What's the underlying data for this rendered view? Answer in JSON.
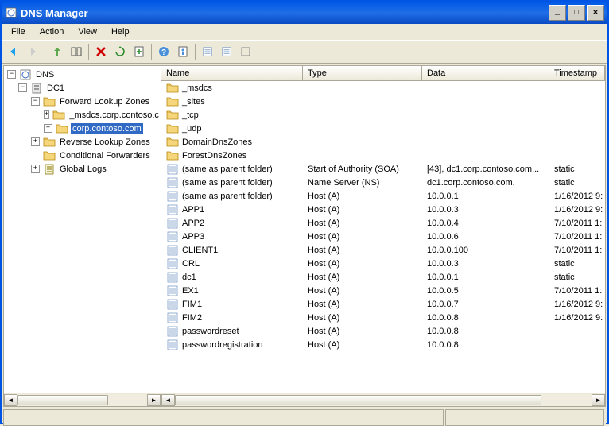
{
  "window": {
    "title": "DNS Manager"
  },
  "menu": {
    "file": "File",
    "action": "Action",
    "view": "View",
    "help": "Help"
  },
  "tree": {
    "root": "DNS",
    "server": "DC1",
    "flz_label": "Forward Lookup Zones",
    "msdcs": "_msdcs.corp.contoso.c",
    "zone": "corp.contoso.com",
    "rlz": "Reverse Lookup Zones",
    "cf": "Conditional Forwarders",
    "gl": "Global Logs"
  },
  "columns": {
    "name": "Name",
    "type": "Type",
    "data": "Data",
    "timestamp": "Timestamp"
  },
  "records": [
    {
      "name": "_msdcs",
      "type": "",
      "data": "",
      "ts": "",
      "icon": "folder"
    },
    {
      "name": "_sites",
      "type": "",
      "data": "",
      "ts": "",
      "icon": "folder"
    },
    {
      "name": "_tcp",
      "type": "",
      "data": "",
      "ts": "",
      "icon": "folder"
    },
    {
      "name": "_udp",
      "type": "",
      "data": "",
      "ts": "",
      "icon": "folder"
    },
    {
      "name": "DomainDnsZones",
      "type": "",
      "data": "",
      "ts": "",
      "icon": "folder"
    },
    {
      "name": "ForestDnsZones",
      "type": "",
      "data": "",
      "ts": "",
      "icon": "folder"
    },
    {
      "name": "(same as parent folder)",
      "type": "Start of Authority (SOA)",
      "data": "[43], dc1.corp.contoso.com...",
      "ts": "static",
      "icon": "record"
    },
    {
      "name": "(same as parent folder)",
      "type": "Name Server (NS)",
      "data": "dc1.corp.contoso.com.",
      "ts": "static",
      "icon": "record"
    },
    {
      "name": "(same as parent folder)",
      "type": "Host (A)",
      "data": "10.0.0.1",
      "ts": "1/16/2012 9:",
      "icon": "record"
    },
    {
      "name": "APP1",
      "type": "Host (A)",
      "data": "10.0.0.3",
      "ts": "1/16/2012 9:",
      "icon": "record"
    },
    {
      "name": "APP2",
      "type": "Host (A)",
      "data": "10.0.0.4",
      "ts": "7/10/2011 1:",
      "icon": "record"
    },
    {
      "name": "APP3",
      "type": "Host (A)",
      "data": "10.0.0.6",
      "ts": "7/10/2011 1:",
      "icon": "record"
    },
    {
      "name": "CLIENT1",
      "type": "Host (A)",
      "data": "10.0.0.100",
      "ts": "7/10/2011 1:",
      "icon": "record"
    },
    {
      "name": "CRL",
      "type": "Host (A)",
      "data": "10.0.0.3",
      "ts": "static",
      "icon": "record"
    },
    {
      "name": "dc1",
      "type": "Host (A)",
      "data": "10.0.0.1",
      "ts": "static",
      "icon": "record"
    },
    {
      "name": "EX1",
      "type": "Host (A)",
      "data": "10.0.0.5",
      "ts": "7/10/2011 1:",
      "icon": "record"
    },
    {
      "name": "FIM1",
      "type": "Host (A)",
      "data": "10.0.0.7",
      "ts": "1/16/2012 9:",
      "icon": "record"
    },
    {
      "name": "FIM2",
      "type": "Host (A)",
      "data": "10.0.0.8",
      "ts": "1/16/2012 9:",
      "icon": "record"
    },
    {
      "name": "passwordreset",
      "type": "Host (A)",
      "data": "10.0.0.8",
      "ts": "",
      "icon": "record"
    },
    {
      "name": "passwordregistration",
      "type": "Host (A)",
      "data": "10.0.0.8",
      "ts": "",
      "icon": "record"
    }
  ]
}
